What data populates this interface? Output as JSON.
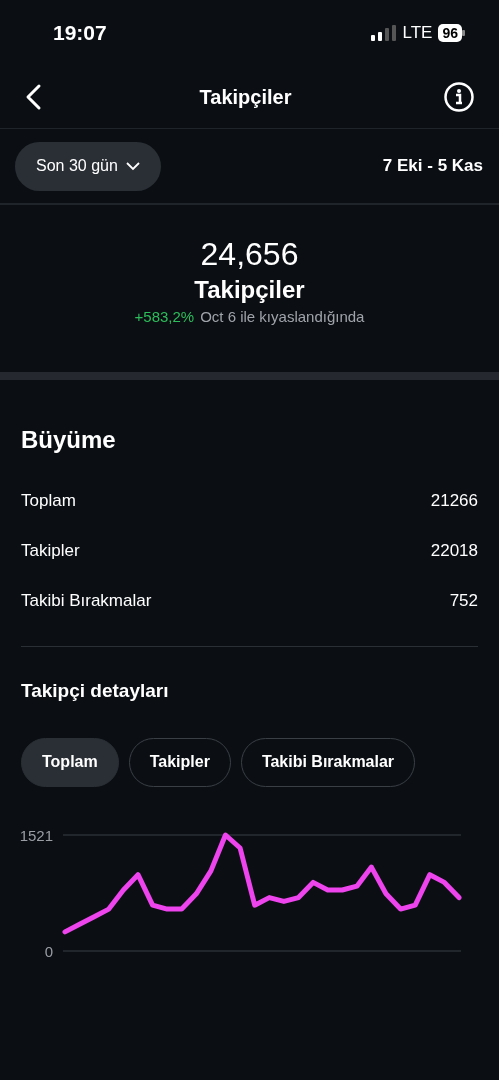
{
  "status_bar": {
    "time": "19:07",
    "network": "LTE",
    "battery": "96"
  },
  "header": {
    "title": "Takipçiler"
  },
  "filter": {
    "range": "Son 30 gün",
    "dates": "7 Eki - 5 Kas"
  },
  "summary": {
    "value": "24,656",
    "label": "Takipçiler",
    "change": "+583,2%",
    "comparison": "Oct 6 ile kıyaslandığında"
  },
  "growth": {
    "title": "Büyüme",
    "rows": [
      {
        "label": "Toplam",
        "value": "21266"
      },
      {
        "label": "Takipler",
        "value": "22018"
      },
      {
        "label": "Takibi Bırakmalar",
        "value": "752"
      }
    ]
  },
  "details": {
    "title": "Takipçi detayları",
    "tabs": [
      {
        "label": "Toplam",
        "selected": true
      },
      {
        "label": "Takipler",
        "selected": false
      },
      {
        "label": "Takibi Bırakmalar",
        "selected": false
      }
    ],
    "chart_data": {
      "type": "line",
      "ylim": [
        0,
        1521
      ],
      "yticks": [
        0,
        1521
      ],
      "series": [
        {
          "color": "#ee44ee",
          "values": [
            250,
            350,
            450,
            550,
            800,
            1000,
            600,
            550,
            550,
            750,
            1050,
            1521,
            1350,
            600,
            700,
            650,
            700,
            900,
            800,
            800,
            850,
            1100,
            750,
            550,
            600,
            1000,
            900,
            700
          ]
        }
      ]
    }
  }
}
